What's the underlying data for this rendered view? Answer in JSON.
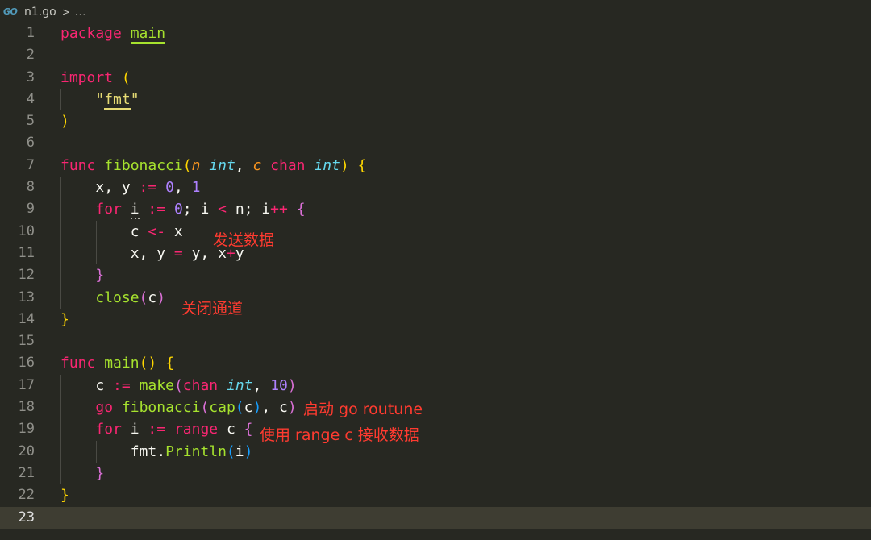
{
  "breadcrumb": {
    "icon": "go-file-icon",
    "file": "n1.go",
    "chevron": ">",
    "more": "..."
  },
  "line_numbers": [
    "1",
    "2",
    "3",
    "4",
    "5",
    "6",
    "7",
    "8",
    "9",
    "10",
    "11",
    "12",
    "13",
    "14",
    "15",
    "16",
    "17",
    "18",
    "19",
    "20",
    "21",
    "22",
    "23"
  ],
  "code": {
    "l1_kw": "package",
    "l1_name": "main",
    "l3_kw": "import",
    "l3_paren": "(",
    "l4_q1": "\"",
    "l4_str": "fmt",
    "l4_q2": "\"",
    "l5_paren": ")",
    "l7_kw": "func",
    "l7_name": "fibonacci",
    "l7_p1": "(",
    "l7_n": "n",
    "l7_int1": "int",
    "l7_comma": ", ",
    "l7_c": "c",
    "l7_chan": "chan",
    "l7_int2": "int",
    "l7_p2": ")",
    "l7_brace": "{",
    "l8_vars": "x, y ",
    "l8_op": ":=",
    "l8_n0": "0",
    "l8_comma": ", ",
    "l8_n1": "1",
    "l9_for": "for",
    "l9_i": "i",
    "l9_op": ":=",
    "l9_n0": "0",
    "l9_semi1": "; i ",
    "l9_lt": "<",
    "l9_semi2": " n; i",
    "l9_inc": "++",
    "l9_brace": "{",
    "l10_c": "c ",
    "l10_op": "<-",
    "l10_x": " x",
    "l11_lhs": "x, y ",
    "l11_eq": "=",
    "l11_mid": " y, x",
    "l11_plus": "+",
    "l11_y": "y",
    "l12_brace": "}",
    "l13_close": "close",
    "l13_p1": "(",
    "l13_c": "c",
    "l13_p2": ")",
    "l14_brace": "}",
    "l16_kw": "func",
    "l16_name": "main",
    "l16_parens": "()",
    "l16_brace": "{",
    "l17_c": "c ",
    "l17_op": ":=",
    "l17_make": "make",
    "l17_p1": "(",
    "l17_chan": "chan",
    "l17_int": "int",
    "l17_comma": ", ",
    "l17_ten": "10",
    "l17_p2": ")",
    "l18_go": "go",
    "l18_fib": "fibonacci",
    "l18_p1": "(",
    "l18_cap": "cap",
    "l18_p2": "(",
    "l18_c1": "c",
    "l18_p3": ")",
    "l18_comma": ", c",
    "l18_p4": ")",
    "l19_for": "for",
    "l19_i": "i ",
    "l19_op": ":=",
    "l19_range": "range",
    "l19_c": "c ",
    "l19_brace": "{",
    "l20_fmt": "fmt.",
    "l20_fn": "Println",
    "l20_p1": "(",
    "l20_i": "i",
    "l20_p2": ")",
    "l21_brace": "}",
    "l22_brace": "}"
  },
  "annotations": {
    "send_data": "发送数据",
    "close_channel": "关闭通道",
    "start_goroutine": "启动 go routune",
    "use_range": "使用 range c 接收数据"
  },
  "colors": {
    "background": "#272822",
    "keyword": "#f92672",
    "function": "#a6e22e",
    "type": "#66d9ef",
    "number": "#ae81ff",
    "annotation": "#ff3b30"
  }
}
